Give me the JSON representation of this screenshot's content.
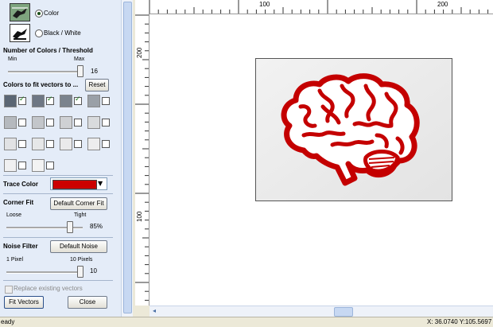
{
  "mode": {
    "color_label": "Color",
    "bw_label": "Black / White",
    "selected": "color"
  },
  "colors_section": {
    "title": "Number of Colors / Threshold",
    "min_label": "Min",
    "max_label": "Max",
    "value": "16",
    "slider_fraction": 1.0
  },
  "fit_section": {
    "title": "Colors to fit vectors to ...",
    "reset_label": "Reset",
    "swatches": [
      {
        "color": "#5b6674",
        "checked": true
      },
      {
        "color": "#6e7784",
        "checked": true
      },
      {
        "color": "#7b838d",
        "checked": true
      },
      {
        "color": "#9aa0a7",
        "checked": false
      },
      {
        "color": "#b5b9be",
        "checked": false
      },
      {
        "color": "#c3c6ca",
        "checked": false
      },
      {
        "color": "#cfd1d4",
        "checked": false
      },
      {
        "color": "#d9dbdd",
        "checked": false
      },
      {
        "color": "#e1e2e4",
        "checked": false
      },
      {
        "color": "#e6e7e8",
        "checked": false
      },
      {
        "color": "#eaeaeb",
        "checked": false
      },
      {
        "color": "#ededee",
        "checked": false
      },
      {
        "color": "#f0f0f1",
        "checked": false
      },
      {
        "color": "#f3f3f3",
        "checked": false
      }
    ]
  },
  "trace_color": {
    "label": "Trace Color",
    "value": "#cc0000"
  },
  "corner_fit": {
    "title": "Corner Fit",
    "button": "Default Corner Fit",
    "loose_label": "Loose",
    "tight_label": "Tight",
    "value": "85%",
    "fraction": 0.85
  },
  "noise_filter": {
    "title": "Noise Filter",
    "button": "Default Noise",
    "min_label": "1 Pixel",
    "max_label": "10 Pixels",
    "value": "10",
    "fraction": 1.0
  },
  "replace_label": "Replace existing vectors",
  "fit_button": "Fit Vectors",
  "close_button": "Close",
  "rulers": {
    "h_100": "100",
    "h_200": "200",
    "v_200": "200",
    "v_100": "100"
  },
  "status": {
    "left": "eady",
    "right": "X: 36.0740 Y:105.5697"
  },
  "colors": {
    "accent": "#cc0000",
    "panel": "#e4ecf8"
  }
}
